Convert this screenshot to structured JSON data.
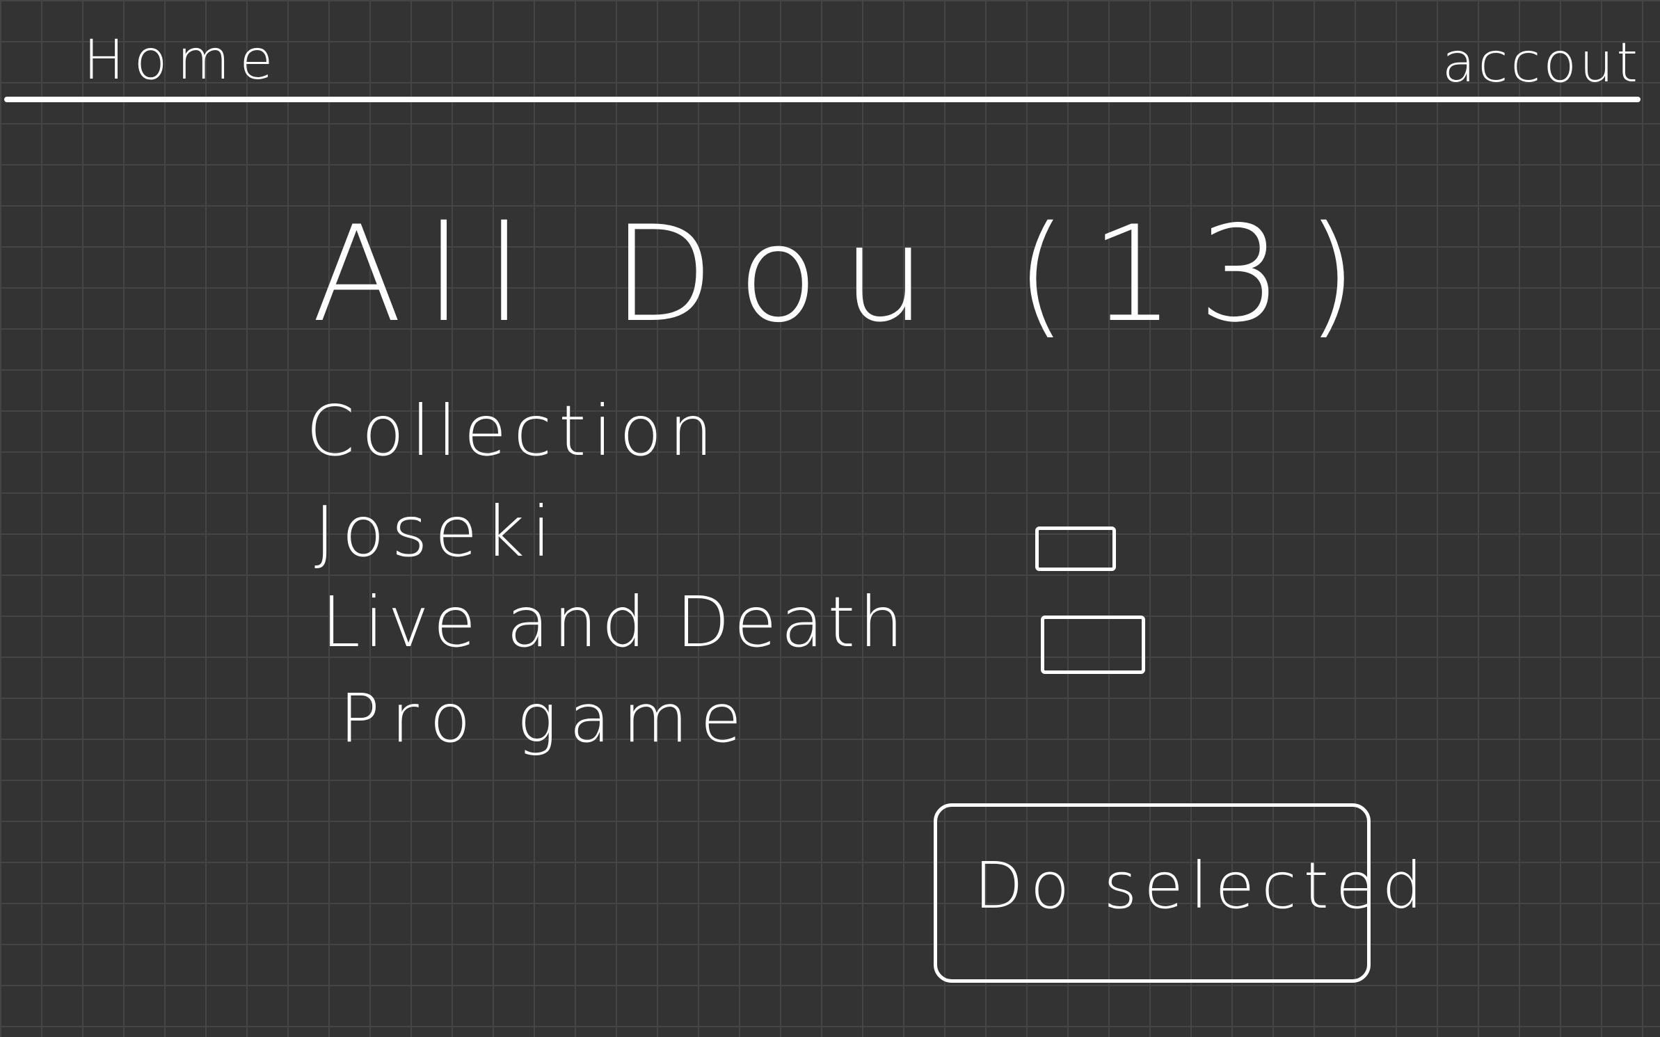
{
  "nav": {
    "home": "Home",
    "account": "accout"
  },
  "main": {
    "title": "All Dou (13)",
    "categories": [
      {
        "label": "Collection"
      },
      {
        "label": "Joseki"
      },
      {
        "label": "Live and Death"
      },
      {
        "label": "Pro game"
      }
    ]
  },
  "action": {
    "label": "Do selected"
  },
  "colors": {
    "background": "#333333",
    "grid": "#454545",
    "ink": "#ffffff"
  }
}
